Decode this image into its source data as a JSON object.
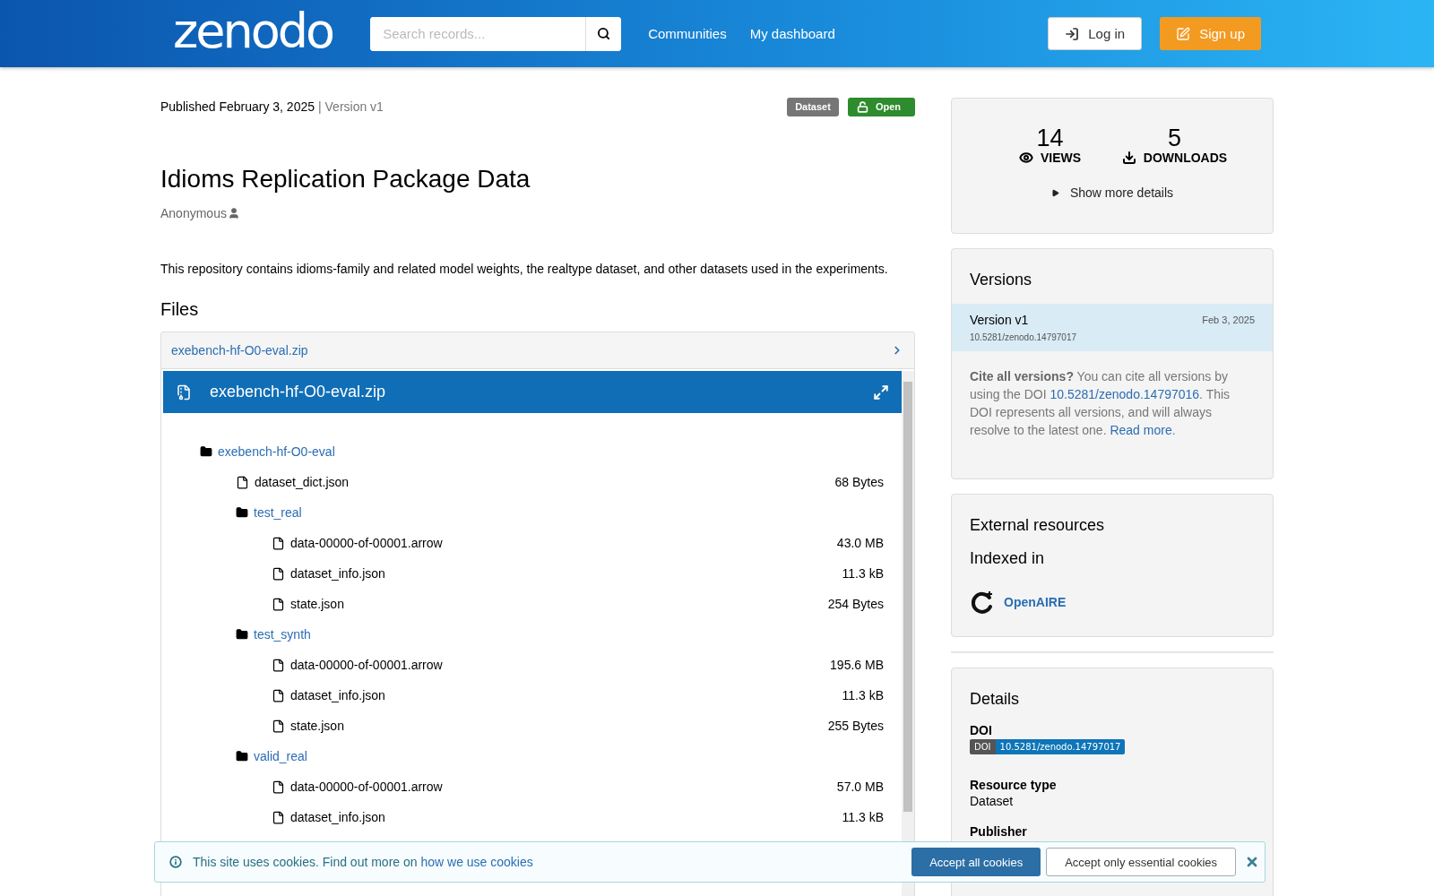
{
  "header": {
    "logo": "zenodo",
    "search": {
      "placeholder": "Search records..."
    },
    "nav": [
      "Communities",
      "My dashboard"
    ],
    "login": "Log in",
    "signup": "Sign up"
  },
  "record": {
    "published": "Published February 3, 2025",
    "version": "| Version v1",
    "badges": [
      {
        "label": "Dataset",
        "kind": "type"
      },
      {
        "label": "Open",
        "kind": "access"
      }
    ],
    "title": "Idioms Replication Package Data",
    "creator": "Anonymous",
    "description": "This repository contains idioms-family and related model weights, the realtype dataset, and other datasets used in the experiments."
  },
  "files": {
    "heading": "Files",
    "accordion": {
      "label": "exebench-hf-O0-eval.zip",
      "expanded": true
    },
    "preview_title": "exebench-hf-O0-eval.zip",
    "tree": [
      {
        "kind": "folder",
        "name": "exebench-hf-O0-eval",
        "children": [
          {
            "kind": "file",
            "name": "dataset_dict.json",
            "size": "68 Bytes"
          },
          {
            "kind": "folder",
            "name": "test_real",
            "children": [
              {
                "kind": "file",
                "name": "data-00000-of-00001.arrow",
                "size": "43.0 MB"
              },
              {
                "kind": "file",
                "name": "dataset_info.json",
                "size": "11.3 kB"
              },
              {
                "kind": "file",
                "name": "state.json",
                "size": "254 Bytes"
              }
            ]
          },
          {
            "kind": "folder",
            "name": "test_synth",
            "children": [
              {
                "kind": "file",
                "name": "data-00000-of-00001.arrow",
                "size": "195.6 MB"
              },
              {
                "kind": "file",
                "name": "dataset_info.json",
                "size": "11.3 kB"
              },
              {
                "kind": "file",
                "name": "state.json",
                "size": "255 Bytes"
              }
            ]
          },
          {
            "kind": "folder",
            "name": "valid_real",
            "children": [
              {
                "kind": "file",
                "name": "data-00000-of-00001.arrow",
                "size": "57.0 MB"
              },
              {
                "kind": "file",
                "name": "dataset_info.json",
                "size": "11.3 kB"
              }
            ]
          }
        ]
      }
    ]
  },
  "stats": {
    "views": "14",
    "views_label": "VIEWS",
    "downloads": "5",
    "downloads_label": "DOWNLOADS",
    "more": "Show more details"
  },
  "versions": {
    "heading": "Versions",
    "items": [
      {
        "label": "Version v1",
        "date": "Feb 3, 2025",
        "doi": "10.5281/zenodo.14797017",
        "selected": true
      }
    ],
    "cite": "**Cite all versions?** You can cite all versions by using the DOI ",
    "cite_doi": "10.5281/zenodo.14797016",
    "cite_tail": ". This DOI represents all versions, and will always resolve to the latest one. ",
    "read_more": "Read more",
    "read_more_tail": "."
  },
  "external": {
    "heading": "External resources",
    "subheading": "Indexed in",
    "items": [
      "OpenAIRE"
    ]
  },
  "details": {
    "heading": "Details",
    "doi_label": "DOI",
    "doi_badge_left": "DOI",
    "doi_badge_right": "10.5281/zenodo.14797017",
    "resource_type_label": "Resource type",
    "resource_type": "Dataset",
    "publisher_label": "Publisher"
  },
  "cookie_banner": {
    "text": "This site uses cookies. Find out more on ",
    "link": "how we use cookies",
    "accept_all": "Accept all cookies",
    "accept_essential": "Accept only essential cookies"
  }
}
